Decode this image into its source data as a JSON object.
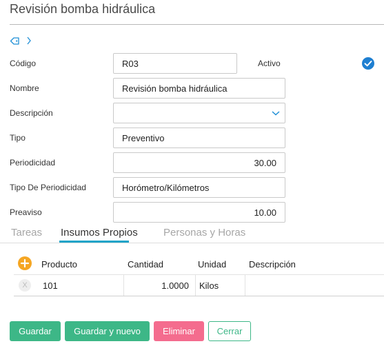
{
  "header": {
    "title": "Revisión bomba hidráulica"
  },
  "tag_icon": "tag-icon",
  "tag_chevron_icon": "chevron-right-icon",
  "form": {
    "codigo": {
      "label": "Código",
      "value": "R03"
    },
    "activo": {
      "label": "Activo",
      "checked": true,
      "icon": "checkmark-circle-icon"
    },
    "nombre": {
      "label": "Nombre",
      "value": "Revisión bomba hidráulica"
    },
    "descripcion": {
      "label": "Descripción",
      "value": "",
      "icon": "chevron-down-icon"
    },
    "tipo": {
      "label": "Tipo",
      "value": "Preventivo"
    },
    "periodicidad": {
      "label": "Periodicidad",
      "value": "30.00"
    },
    "tipo_periodicidad": {
      "label": "Tipo De Periodicidad",
      "value": "Horómetro/Kilómetros"
    },
    "preaviso": {
      "label": "Preaviso",
      "value": "10.00"
    }
  },
  "tabs": [
    {
      "label": "Tareas",
      "active": false
    },
    {
      "label": "Insumos Propios",
      "active": true
    },
    {
      "label": "Personas y Horas",
      "active": false
    }
  ],
  "grid": {
    "add_icon": "plus-circle-icon",
    "columns": [
      "Producto",
      "Cantidad",
      "Unidad",
      "Descripción"
    ],
    "rows": [
      {
        "delete": "X",
        "producto": "101",
        "cantidad": "1.0000",
        "unidad": "Kilos",
        "descripcion": ""
      }
    ]
  },
  "buttons": {
    "guardar": "Guardar",
    "guardar_nuevo": "Guardar y nuevo",
    "eliminar": "Eliminar",
    "cerrar": "Cerrar"
  },
  "colors": {
    "primary_green": "#3db787",
    "danger_pink": "#f46c8e",
    "tab_accent": "#1aa3c8",
    "check_blue": "#1e7fd1",
    "add_orange": "#f5a623"
  }
}
